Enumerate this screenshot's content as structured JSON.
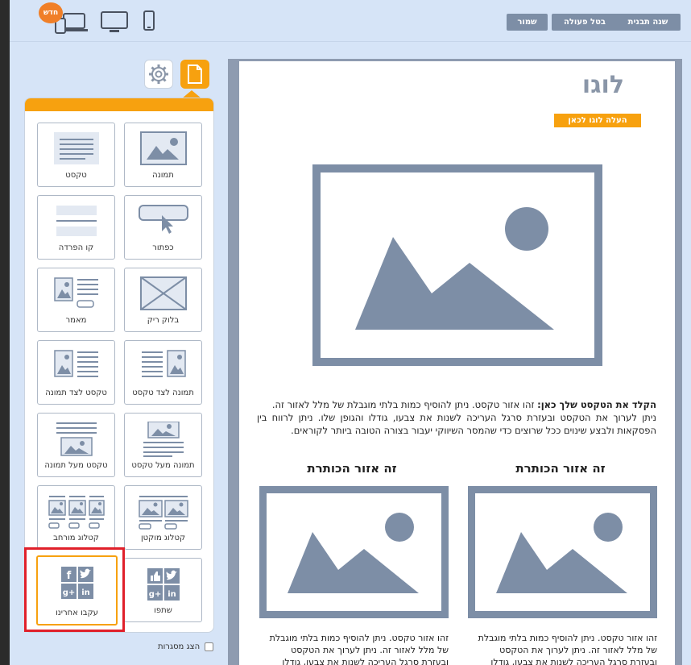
{
  "topbar": {
    "change_template": "שנה תבנית",
    "undo": "בטל פעולה",
    "save": "שמור",
    "new_badge": "חדש"
  },
  "sidebar": {
    "tiles": [
      {
        "label": "תמונה"
      },
      {
        "label": "טקסט"
      },
      {
        "label": "כפתור"
      },
      {
        "label": "קו הפרדה"
      },
      {
        "label": "בלוק ריק"
      },
      {
        "label": "מאמר"
      },
      {
        "label": "תמונה לצד טקסט"
      },
      {
        "label": "טקסט לצד תמונה"
      },
      {
        "label": "תמונה מעל טקסט"
      },
      {
        "label": "טקסט מעל תמונה"
      },
      {
        "label": "קטלוג מוקטן"
      },
      {
        "label": "קטלוג מורחב"
      },
      {
        "label": "שתפו"
      },
      {
        "label": "עקבו אחרינו"
      }
    ],
    "show_frames": "הצג מסגרות"
  },
  "canvas": {
    "logo": "לוגו",
    "upload_logo": "העלה לוגו לכאן",
    "intro_bold": "הקלד את הטקסט שלך כאן:",
    "intro_line1": " זהו אזור טקסט. ניתן להוסיף כמות בלתי מוגבלת של מלל לאזור זה.",
    "intro_line2": "ניתן לערוך את הטקסט ובעזרת סרגל העריכה לשנות את צבעו, גודלו והגופן שלו. ניתן לרווח בין הפסקאות ולבצע שינוים ככל שרוצים כדי שהמסר השיווקי יעבור בצורה הטובה ביותר לקוראים.",
    "col_right_title": "זה אזור הכותרת",
    "col_left_title": "זה אזור הכותרת",
    "col_text_1": "זהו אזור טקסט. ניתן להוסיף כמות בלתי מוגבלת",
    "col_text_2": "של מלל לאזור זה. ניתן לערוך את הטקסט",
    "col_text_3": "ובעזרת סרגל העריכה לשנות את צבעו, גודלו"
  },
  "colors": {
    "accent": "#f7a10f",
    "icon": "#7d8ea6",
    "highlight": "#e0202a"
  }
}
